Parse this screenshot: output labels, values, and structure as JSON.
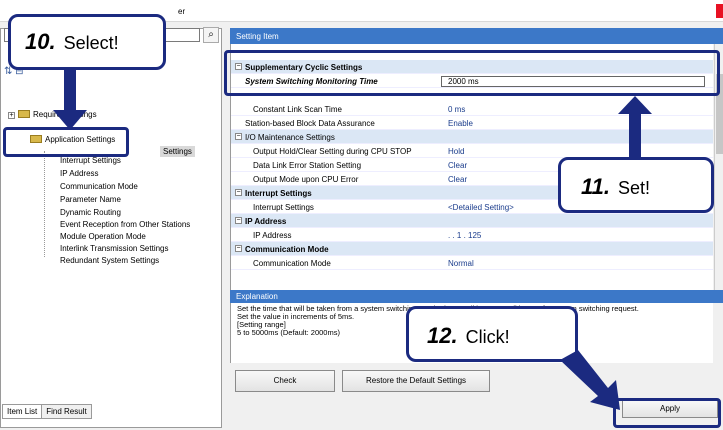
{
  "window": {
    "title_fragment": "er"
  },
  "left": {
    "tree": [
      {
        "label": "Required Settings",
        "collapsed": true
      },
      {
        "label": "Application Settings",
        "expanded": true
      },
      {
        "label": "Settings"
      }
    ],
    "children": [
      "Interrupt Settings",
      "IP Address",
      "Communication Mode",
      "Parameter Name",
      "Dynamic Routing",
      "Event Reception from Other Stations",
      "Module Operation Mode",
      "Interlink Transmission Settings",
      "Redundant System Settings"
    ],
    "tabs": [
      "Item List",
      "Find Result"
    ]
  },
  "right": {
    "setting_header": "Setting Item",
    "rows": [
      {
        "label": "Supplementary Cyclic Settings",
        "value": "",
        "type": "cat"
      },
      {
        "label": "System Switching Monitoring Time",
        "value": "2000 ms",
        "type": "edit"
      },
      {
        "label": "Constant Link Scan Time",
        "value": "0 ms",
        "type": "item"
      },
      {
        "label": "Station-based Block Data Assurance",
        "value": "Enable",
        "type": "item"
      },
      {
        "label": "I/O Maintenance Settings",
        "value": "",
        "type": "sub"
      },
      {
        "label": "Output Hold/Clear Setting during CPU STOP",
        "value": "Hold",
        "type": "item2"
      },
      {
        "label": "Data Link Error Station Setting",
        "value": "Clear",
        "type": "item2"
      },
      {
        "label": "Output Mode upon CPU Error",
        "value": "Clear",
        "type": "item2"
      },
      {
        "label": "Interrupt Settings",
        "value": "",
        "type": "cat"
      },
      {
        "label": "Interrupt Settings",
        "value": "<Detailed Setting>",
        "type": "item"
      },
      {
        "label": "IP Address",
        "value": "",
        "type": "cat"
      },
      {
        "label": "IP Address",
        "value": ". . 1 . 125",
        "type": "item"
      },
      {
        "label": "Communication Mode",
        "value": "",
        "type": "cat"
      },
      {
        "label": "Communication Mode",
        "value": "Normal",
        "type": "item"
      }
    ],
    "explanation_header": "Explanation",
    "explanation": "Set the time that will be taken from a system switching monitoring condition met until issue of a system switching request.\nSet the value in increments of 5ms.\n[Setting range]\n5 to 5000ms (Default: 2000ms)",
    "buttons": {
      "check": "Check",
      "restore": "Restore the Default Settings",
      "apply": "Apply"
    }
  },
  "callouts": [
    {
      "num": "10.",
      "text": "Select!"
    },
    {
      "num": "11.",
      "text": "Set!"
    },
    {
      "num": "12.",
      "text": "Click!"
    }
  ],
  "colors": {
    "accent": "#1b2a80",
    "header": "#3c78c8",
    "category_bg": "#dbe7f5"
  }
}
